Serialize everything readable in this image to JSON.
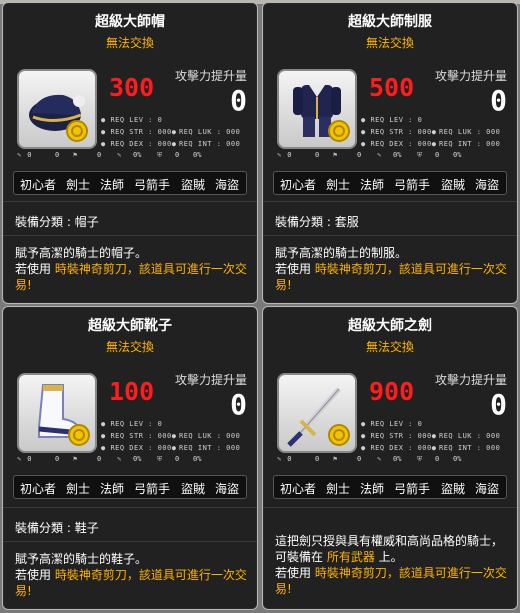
{
  "panels": [
    {
      "title": "超級大師帽",
      "tradable": "無法交換",
      "number": "300",
      "atk_label": "攻擊力提升量",
      "atk_value": "0",
      "req_lev": "REQ LEV :",
      "req_lev_val": "0",
      "req_str": "REQ STR :",
      "req_str_val": "000",
      "req_luk": "REQ LUK :",
      "req_luk_val": "000",
      "req_dex": "REQ DEX :",
      "req_dex_val": "000",
      "req_int": "REQ INT :",
      "req_int_val": "000",
      "stats": [
        "0",
        "0",
        "0",
        "0%",
        "0",
        "0%"
      ],
      "jobs": [
        "初心者",
        "劍士",
        "法師",
        "弓箭手",
        "盜賊",
        "海盜"
      ],
      "category_label": "裝備分類 :",
      "category_value": "帽子",
      "desc_line1": "賦予高潔的騎士的帽子。",
      "desc_prefix": "若使用 ",
      "desc_highlight": "時裝神奇剪刀，該道具可進行一次交易!",
      "desc_extra": "",
      "icon": "navy-hat-icon"
    },
    {
      "title": "超級大師制服",
      "tradable": "無法交換",
      "number": "500",
      "atk_label": "攻擊力提升量",
      "atk_value": "0",
      "req_lev": "REQ LEV :",
      "req_lev_val": "0",
      "req_str": "REQ STR :",
      "req_str_val": "000",
      "req_luk": "REQ LUK :",
      "req_luk_val": "000",
      "req_dex": "REQ DEX :",
      "req_dex_val": "000",
      "req_int": "REQ INT :",
      "req_int_val": "000",
      "stats": [
        "0",
        "0",
        "0",
        "0%",
        "0",
        "0%"
      ],
      "jobs": [
        "初心者",
        "劍士",
        "法師",
        "弓箭手",
        "盜賊",
        "海盜"
      ],
      "category_label": "裝備分類 :",
      "category_value": "套服",
      "desc_line1": "賦予高潔的騎士的制服。",
      "desc_prefix": "若使用 ",
      "desc_highlight": "時裝神奇剪刀，該道具可進行一次交易!",
      "desc_extra": "",
      "icon": "navy-uniform-icon"
    },
    {
      "title": "超級大師靴子",
      "tradable": "無法交換",
      "number": "100",
      "atk_label": "攻擊力提升量",
      "atk_value": "0",
      "req_lev": "REQ LEV :",
      "req_lev_val": "0",
      "req_str": "REQ STR :",
      "req_str_val": "000",
      "req_luk": "REQ LUK :",
      "req_luk_val": "000",
      "req_dex": "REQ DEX :",
      "req_dex_val": "000",
      "req_int": "REQ INT :",
      "req_int_val": "000",
      "stats": [
        "0",
        "0",
        "0",
        "0%",
        "0",
        "0%"
      ],
      "jobs": [
        "初心者",
        "劍士",
        "法師",
        "弓箭手",
        "盜賊",
        "海盜"
      ],
      "category_label": "裝備分類 :",
      "category_value": "鞋子",
      "desc_line1": "賦予高潔的騎士的鞋子。",
      "desc_prefix": "若使用 ",
      "desc_highlight": "時裝神奇剪刀，該道具可進行一次交易!",
      "desc_extra": "",
      "icon": "white-boot-icon"
    },
    {
      "title": "超級大師之劍",
      "tradable": "無法交換",
      "number": "900",
      "atk_label": "攻擊力提升量",
      "atk_value": "0",
      "req_lev": "REQ LEV :",
      "req_lev_val": "0",
      "req_str": "REQ STR :",
      "req_str_val": "000",
      "req_luk": "REQ LUK :",
      "req_luk_val": "000",
      "req_dex": "REQ DEX :",
      "req_dex_val": "000",
      "req_int": "REQ INT :",
      "req_int_val": "000",
      "stats": [
        "0",
        "0",
        "0",
        "0%",
        "0",
        "0%"
      ],
      "jobs": [
        "初心者",
        "劍士",
        "法師",
        "弓箭手",
        "盜賊",
        "海盜"
      ],
      "category_label": "",
      "category_value": "",
      "desc_line1": "這把劍只授與具有權威和高尚品格的騎士，",
      "desc_mid_prefix": "可裝備在 ",
      "desc_mid_highlight": "所有武器",
      "desc_mid_suffix": " 上。",
      "desc_prefix": "若使用 ",
      "desc_highlight": "時裝神奇剪刀，該道具可進行一次交易!",
      "desc_extra": "",
      "icon": "sword-icon"
    }
  ],
  "colors": {
    "accent_orange": "#ffb300",
    "number_red": "#ff1c1c",
    "panel_bg": "#141416"
  }
}
